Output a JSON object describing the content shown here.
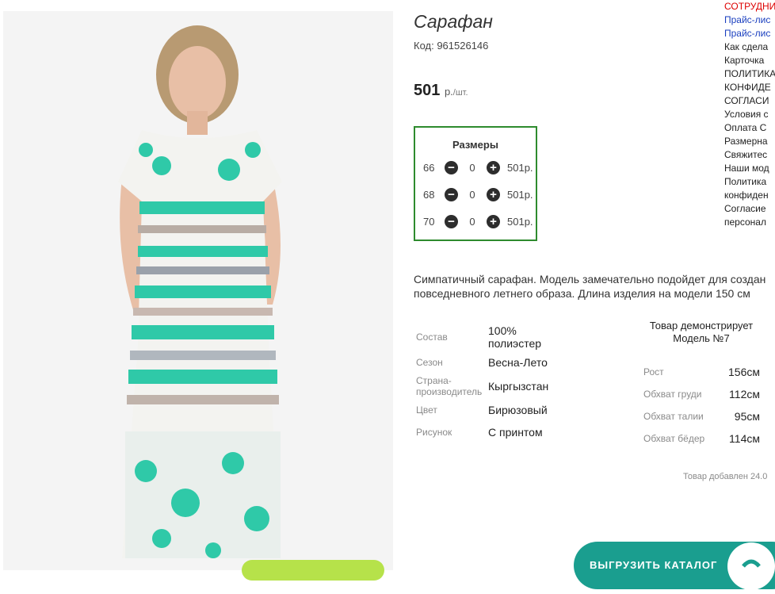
{
  "product": {
    "title": "Сарафан",
    "code": "Код: 961526146",
    "price": "501",
    "price_unit": "р.",
    "price_per": "/шт."
  },
  "sizes": {
    "title": "Размеры",
    "rows": [
      {
        "size": "66",
        "minus": "−",
        "qty": "0",
        "plus": "+",
        "price": "501р."
      },
      {
        "size": "68",
        "minus": "−",
        "qty": "0",
        "plus": "+",
        "price": "501р."
      },
      {
        "size": "70",
        "minus": "−",
        "qty": "0",
        "plus": "+",
        "price": "501р."
      }
    ]
  },
  "menu": [
    {
      "text": "СОТРУДНИ",
      "color": "red"
    },
    {
      "text": "Прайс-лис",
      "color": "blue"
    },
    {
      "text": "Прайс-лис",
      "color": "blue"
    },
    {
      "text": "Как сдела",
      "color": "blk"
    },
    {
      "text": "Карточка",
      "color": "blk"
    },
    {
      "text": "ПОЛИТИКА",
      "color": "blk"
    },
    {
      "text": "КОНФИДЕ",
      "color": "blk"
    },
    {
      "text": "СОГЛАСИ",
      "color": "blk"
    },
    {
      "text": "Условия с",
      "color": "blk"
    },
    {
      "text": "Оплата С",
      "color": "blk"
    },
    {
      "text": "Размерна",
      "color": "blk"
    },
    {
      "text": "Свяжитес",
      "color": "blk"
    },
    {
      "text": "Наши мод",
      "color": "blk"
    },
    {
      "text": "Политика",
      "color": "blk"
    },
    {
      "text": "конфиден",
      "color": "blk"
    },
    {
      "text": "Согласие",
      "color": "blk"
    },
    {
      "text": "персонал",
      "color": "blk"
    }
  ],
  "description": {
    "line1": "Симпатичный сарафан. Модель замечательно подойдет для создан",
    "line2": "повседневного летнего образа. Длина изделия на модели 150 см"
  },
  "properties": [
    {
      "label": "Состав",
      "value": "100% полиэстер"
    },
    {
      "label": "Сезон",
      "value": "Весна-Лето"
    },
    {
      "label": "Страна-производитель",
      "value": "Кыргызстан"
    },
    {
      "label": "Цвет",
      "value": "Бирюзовый"
    },
    {
      "label": "Рисунок",
      "value": "С принтом"
    }
  ],
  "model": {
    "title": "Товар демонстрирует Модель №7",
    "rows": [
      {
        "label": "Рост",
        "value": "156см"
      },
      {
        "label": "Обхват груди",
        "value": "112см"
      },
      {
        "label": "Обхват талии",
        "value": "95см"
      },
      {
        "label": "Обхват бёдер",
        "value": "114см"
      }
    ]
  },
  "added": "Товар добавлен 24.0",
  "export_button": "ВЫГРУЗИТЬ КАТАЛОГ",
  "colors": {
    "sizes_border": "#2e8b2e",
    "export_bg": "#1a9e8f",
    "dress_accent": "#2fc9a8",
    "menu_red": "#dd0000",
    "menu_blue": "#1a3fbf"
  }
}
